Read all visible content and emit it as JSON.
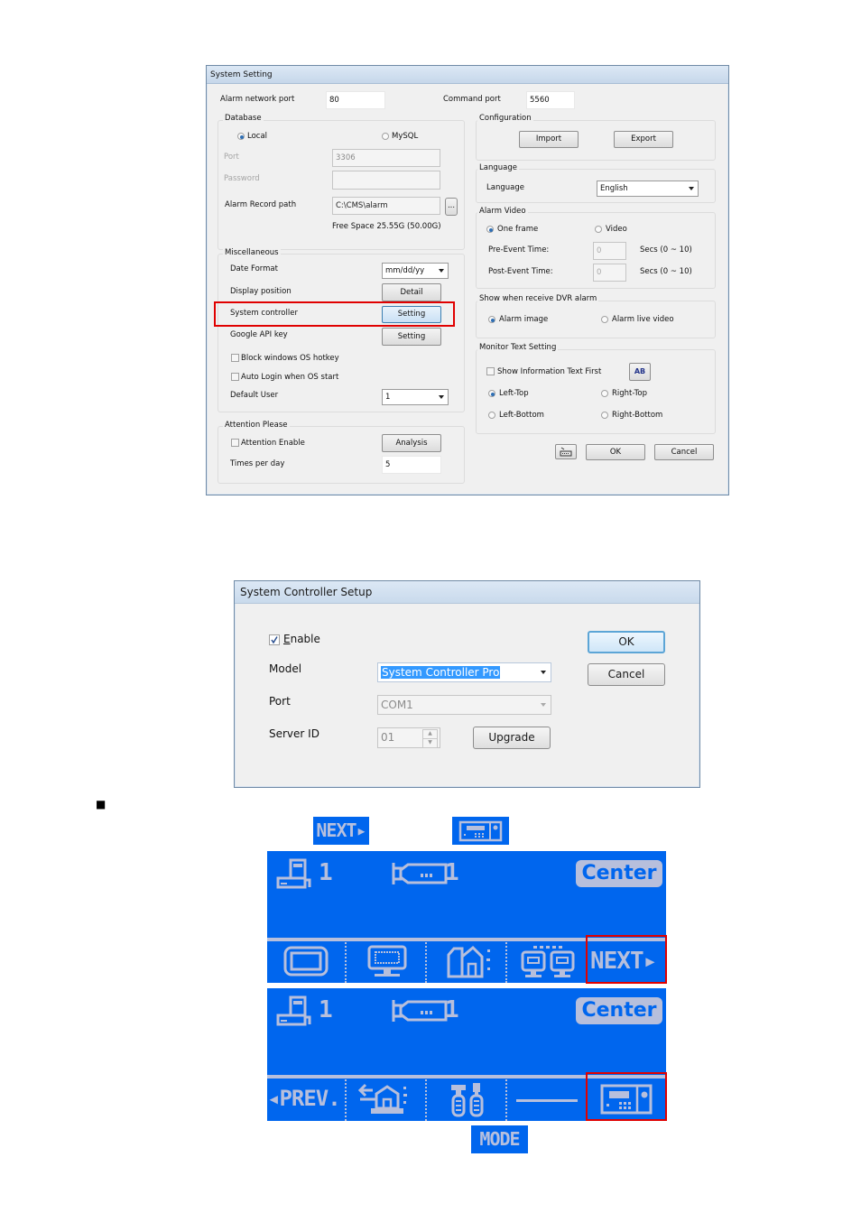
{
  "system_setting": {
    "title": "System Setting",
    "alarm_network_port": {
      "label": "Alarm network port",
      "value": "80"
    },
    "command_port": {
      "label": "Command port",
      "value": "5560"
    },
    "database": {
      "group_title": "Database",
      "options": [
        {
          "label": "Local",
          "selected": true
        },
        {
          "label": "MySQL",
          "selected": false
        }
      ],
      "port": {
        "label": "Port",
        "value": "3306"
      },
      "password": {
        "label": "Password",
        "value": ""
      },
      "alarm_record_path": {
        "label": "Alarm Record path",
        "value": "C:\\CMS\\alarm",
        "browse_label": "..."
      },
      "free_space": "Free Space 25.55G (50.00G)"
    },
    "miscellaneous": {
      "group_title": "Miscellaneous",
      "date_format": {
        "label": "Date Format",
        "value": "mm/dd/yy"
      },
      "display_position": {
        "label": "Display position",
        "button": "Detail"
      },
      "system_controller": {
        "label": "System controller",
        "button": "Setting"
      },
      "google_api_key": {
        "label": "Google API key",
        "button": "Setting"
      },
      "block_hotkey": {
        "label": "Block windows OS hotkey",
        "checked": false
      },
      "auto_login": {
        "label": "Auto Login when OS start",
        "checked": false
      },
      "default_user": {
        "label": "Default User",
        "value": "1"
      }
    },
    "attention": {
      "group_title": "Attention Please",
      "enable": {
        "label": "Attention Enable",
        "checked": false
      },
      "analysis_button": "Analysis",
      "times_per_day": {
        "label": "Times per day",
        "value": "5"
      }
    },
    "configuration": {
      "group_title": "Configuration",
      "import": "Import",
      "export": "Export"
    },
    "language": {
      "group_title": "Language",
      "label": "Language",
      "value": "English"
    },
    "alarm_video": {
      "group_title": "Alarm Video",
      "options": [
        {
          "label": "One frame",
          "selected": true
        },
        {
          "label": "Video",
          "selected": false
        }
      ],
      "pre_event": {
        "label": "Pre-Event Time:",
        "value": "0",
        "unit": "Secs  (0 ~ 10)"
      },
      "post_event": {
        "label": "Post-Event Time:",
        "value": "0",
        "unit": "Secs  (0 ~ 10)"
      }
    },
    "dvr_alarm": {
      "group_title": "Show when receive DVR alarm",
      "options": [
        {
          "label": "Alarm image",
          "selected": true
        },
        {
          "label": "Alarm live video",
          "selected": false
        }
      ]
    },
    "monitor_text": {
      "group_title": "Monitor Text Setting",
      "show_info_first": {
        "label": "Show Information Text First",
        "checked": false
      },
      "font_button": "AB",
      "positions": [
        {
          "label": "Left-Top",
          "selected": true
        },
        {
          "label": "Right-Top",
          "selected": false
        },
        {
          "label": "Left-Bottom",
          "selected": false
        },
        {
          "label": "Right-Bottom",
          "selected": false
        }
      ]
    },
    "footer": {
      "keyboard_icon": "keyboard-icon",
      "ok": "OK",
      "cancel": "Cancel"
    }
  },
  "controller_setup": {
    "title": "System Controller Setup",
    "enable": {
      "label_prefix": "E",
      "label_rest": "nable",
      "checked": true
    },
    "model": {
      "label": "Model",
      "value": "System Controller Pro"
    },
    "port": {
      "label": "Port",
      "value": "COM1"
    },
    "server_id": {
      "label": "Server ID",
      "value": "01"
    },
    "upgrade": "Upgrade",
    "ok": "OK",
    "cancel": "Cancel"
  },
  "instructions": {
    "bullet": "■",
    "next_badge": "NEXT▸",
    "mode_badge": "MODE"
  },
  "lcd_screens": [
    {
      "dvr_count": "1",
      "camera_count": "1",
      "center_tag": "Center",
      "softkeys": [
        "monitor-icon",
        "keyboard-monitor-icon",
        "alarm-house-icon",
        "twin-monitors-icon",
        "NEXT▸"
      ],
      "highlighted": 4
    },
    {
      "dvr_count": "1",
      "camera_count": "1",
      "center_tag": "Center",
      "softkeys": [
        "◂PREV.",
        "alarm-siren-icon",
        "tools-icon",
        "blank",
        "controller-icon"
      ],
      "highlighted": 4
    }
  ],
  "colors": {
    "lcd_bg": "#0066ee",
    "lcd_fg": "#b7bfdc",
    "highlight": "#e00000"
  }
}
